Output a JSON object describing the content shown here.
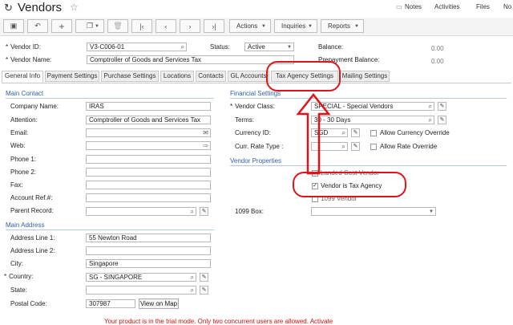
{
  "window": {
    "title": "Vendors"
  },
  "top_links": [
    "Notes",
    "Activities",
    "Files",
    "No"
  ],
  "toolbar": {
    "actions_label": "Actions",
    "inquiries_label": "Inquiries",
    "reports_label": "Reports"
  },
  "header": {
    "vendor_id_label": "Vendor ID:",
    "vendor_id_value": "V3-C006-01",
    "status_label": "Status:",
    "status_value": "Active",
    "balance_label": "Balance:",
    "balance_value": "0.00",
    "vendor_name_label": "Vendor Name:",
    "vendor_name_value": "Comptroller of Goods and Services Tax",
    "prepayment_label": "Prepayment Balance:",
    "prepayment_value": "0.00"
  },
  "tabs": [
    "General Info",
    "Payment Settings",
    "Purchase Settings",
    "Locations",
    "Contacts",
    "GL Accounts",
    "Tax Agency Settings",
    "Mailing Settings"
  ],
  "main_contact": {
    "heading": "Main Contact",
    "company_name_label": "Company Name:",
    "company_name_value": "IRAS",
    "attention_label": "Attention:",
    "attention_value": "Comptroller of Goods and Services Tax",
    "email_label": "Email:",
    "web_label": "Web:",
    "phone1_label": "Phone 1:",
    "phone2_label": "Phone 2:",
    "fax_label": "Fax:",
    "account_ref_label": "Account Ref.#:",
    "parent_record_label": "Parent Record:"
  },
  "main_address": {
    "heading": "Main Address",
    "line1_label": "Address Line 1:",
    "line1_value": "55 Newton Road",
    "line2_label": "Address Line 2:",
    "city_label": "City:",
    "city_value": "Singapore",
    "country_label": "Country:",
    "country_value": "SG - SINGAPORE",
    "state_label": "State:",
    "postal_label": "Postal Code:",
    "postal_value": "307987",
    "map_button": "View on Map"
  },
  "financial": {
    "heading": "Financial Settings",
    "vendor_class_label": "Vendor Class:",
    "vendor_class_value": "SPECIAL - Special Vendors",
    "terms_label": "Terms:",
    "terms_value": "30 - 30 Days",
    "currency_label": "Currency ID:",
    "currency_value": "SGD",
    "allow_currency_override": "Allow Currency Override",
    "rate_type_label": "Curr. Rate Type :",
    "allow_rate_override": "Allow Rate Override"
  },
  "vendor_properties": {
    "heading": "Vendor Properties",
    "landed_cost": "Landed Cost Vendor",
    "tax_agency": "Vendor is Tax Agency",
    "vendor_1099": "1099 Vendor",
    "box_1099_label": "1099 Box:"
  },
  "trial_notice": "Your product is in the trial mode. Only two concurrent users are allowed. Activate"
}
